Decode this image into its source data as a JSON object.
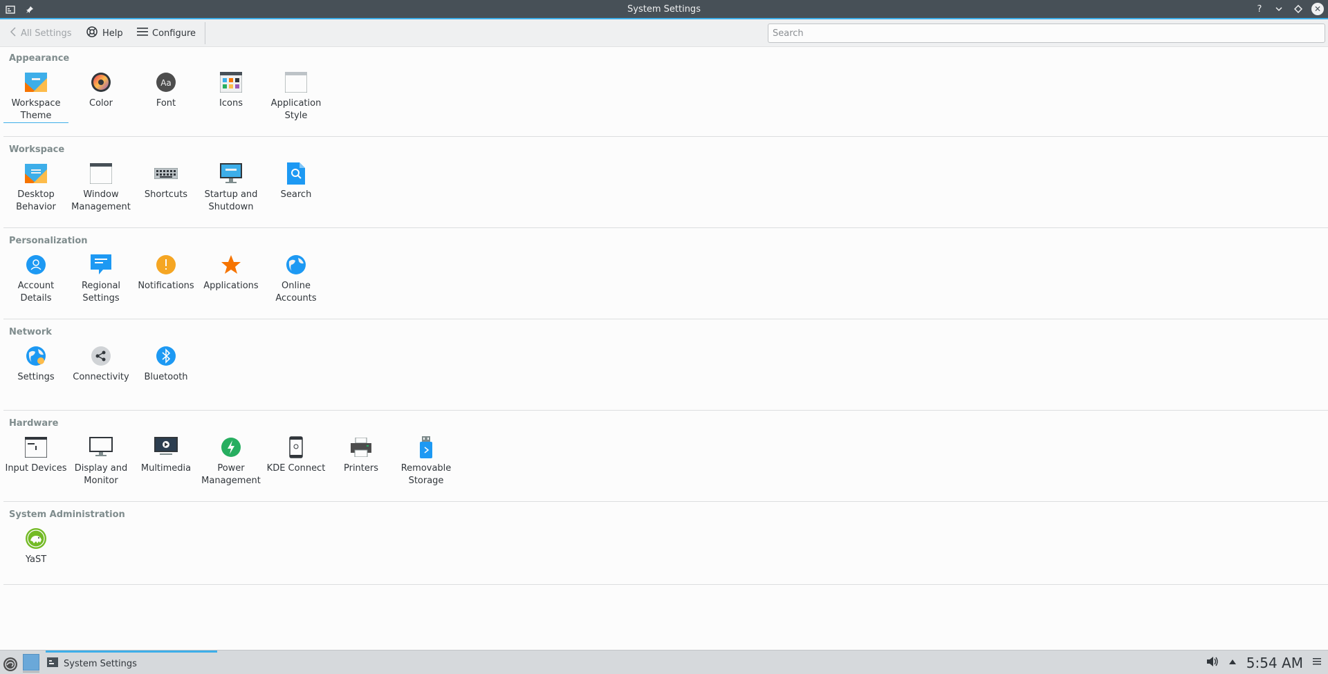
{
  "window": {
    "title": "System Settings"
  },
  "toolbar": {
    "all_settings_label": "All Settings",
    "help_label": "Help",
    "configure_label": "Configure",
    "search_placeholder": "Search"
  },
  "sections": [
    {
      "title": "Appearance",
      "items": [
        {
          "label": "Workspace Theme",
          "icon": "workspace-theme-icon"
        },
        {
          "label": "Color",
          "icon": "color-icon"
        },
        {
          "label": "Font",
          "icon": "font-icon"
        },
        {
          "label": "Icons",
          "icon": "icons-icon"
        },
        {
          "label": "Application Style",
          "icon": "application-style-icon"
        }
      ]
    },
    {
      "title": "Workspace",
      "items": [
        {
          "label": "Desktop Behavior",
          "icon": "desktop-behavior-icon"
        },
        {
          "label": "Window Management",
          "icon": "window-management-icon"
        },
        {
          "label": "Shortcuts",
          "icon": "keyboard-icon"
        },
        {
          "label": "Startup and Shutdown",
          "icon": "startup-shutdown-icon"
        },
        {
          "label": "Search",
          "icon": "search-icon"
        }
      ]
    },
    {
      "title": "Personalization",
      "items": [
        {
          "label": "Account Details",
          "icon": "account-icon"
        },
        {
          "label": "Regional Settings",
          "icon": "regional-settings-icon"
        },
        {
          "label": "Notifications",
          "icon": "notifications-icon"
        },
        {
          "label": "Applications",
          "icon": "star-icon"
        },
        {
          "label": "Online Accounts",
          "icon": "globe-icon"
        }
      ]
    },
    {
      "title": "Network",
      "items": [
        {
          "label": "Settings",
          "icon": "network-settings-icon"
        },
        {
          "label": "Connectivity",
          "icon": "share-icon"
        },
        {
          "label": "Bluetooth",
          "icon": "bluetooth-icon"
        }
      ]
    },
    {
      "title": "Hardware",
      "items": [
        {
          "label": "Input Devices",
          "icon": "input-devices-icon"
        },
        {
          "label": "Display and Monitor",
          "icon": "monitor-icon"
        },
        {
          "label": "Multimedia",
          "icon": "multimedia-icon"
        },
        {
          "label": "Power Management",
          "icon": "power-icon"
        },
        {
          "label": "KDE Connect",
          "icon": "phone-icon"
        },
        {
          "label": "Printers",
          "icon": "printer-icon"
        },
        {
          "label": "Removable Storage",
          "icon": "usb-storage-icon"
        }
      ]
    },
    {
      "title": "System Administration",
      "items": [
        {
          "label": "YaST",
          "icon": "yast-icon"
        }
      ]
    }
  ],
  "taskbar": {
    "task_label": "System Settings",
    "clock": "5:54 AM"
  },
  "colors": {
    "accent": "#3daee9",
    "titlebar": "#475057",
    "toolbar": "#eff0f1",
    "background": "#fcfcfc"
  }
}
